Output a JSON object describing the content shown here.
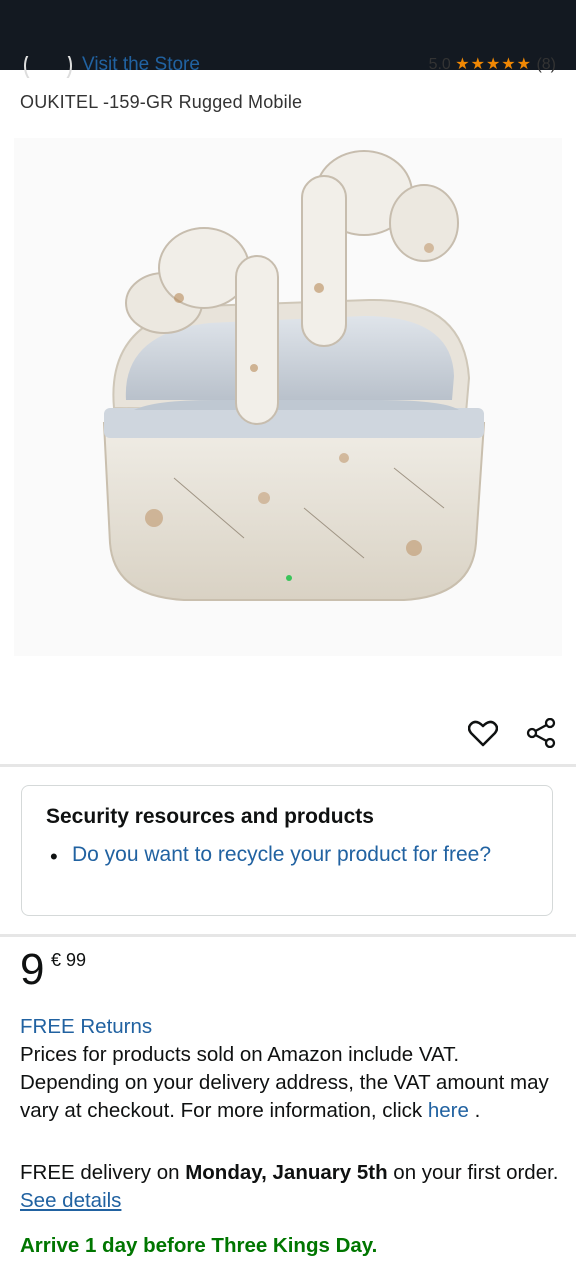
{
  "store": {
    "link": "Visit the Store",
    "rating_value": "5.0",
    "stars": "★★★★★",
    "rating_count": "(8)"
  },
  "product": {
    "title": "OUKITEL -159-GR Rugged Mobile",
    "image_alt": "Rugged white earbuds with charging case"
  },
  "card": {
    "heading": "Security resources and products",
    "bullet": "•",
    "link": "Do you want to recycle your product for free?"
  },
  "price": {
    "whole": "9",
    "currency_fraction": "€ 99"
  },
  "returns": "FREE Returns",
  "vat": {
    "text": "Prices for products sold on Amazon include VAT. Depending on your delivery address, the VAT amount may vary at checkout. For more information, click",
    "link": "here",
    "tail": " ."
  },
  "delivery": {
    "prefix": "FREE delivery on ",
    "date": "Monday, January 5th",
    "suffix": " on your first order. ",
    "link": "See details"
  },
  "arrive": "Arrive 1 day before Three Kings Day.",
  "colors": {
    "link": "#2162a1",
    "green": "#007600",
    "header": "#131921"
  }
}
